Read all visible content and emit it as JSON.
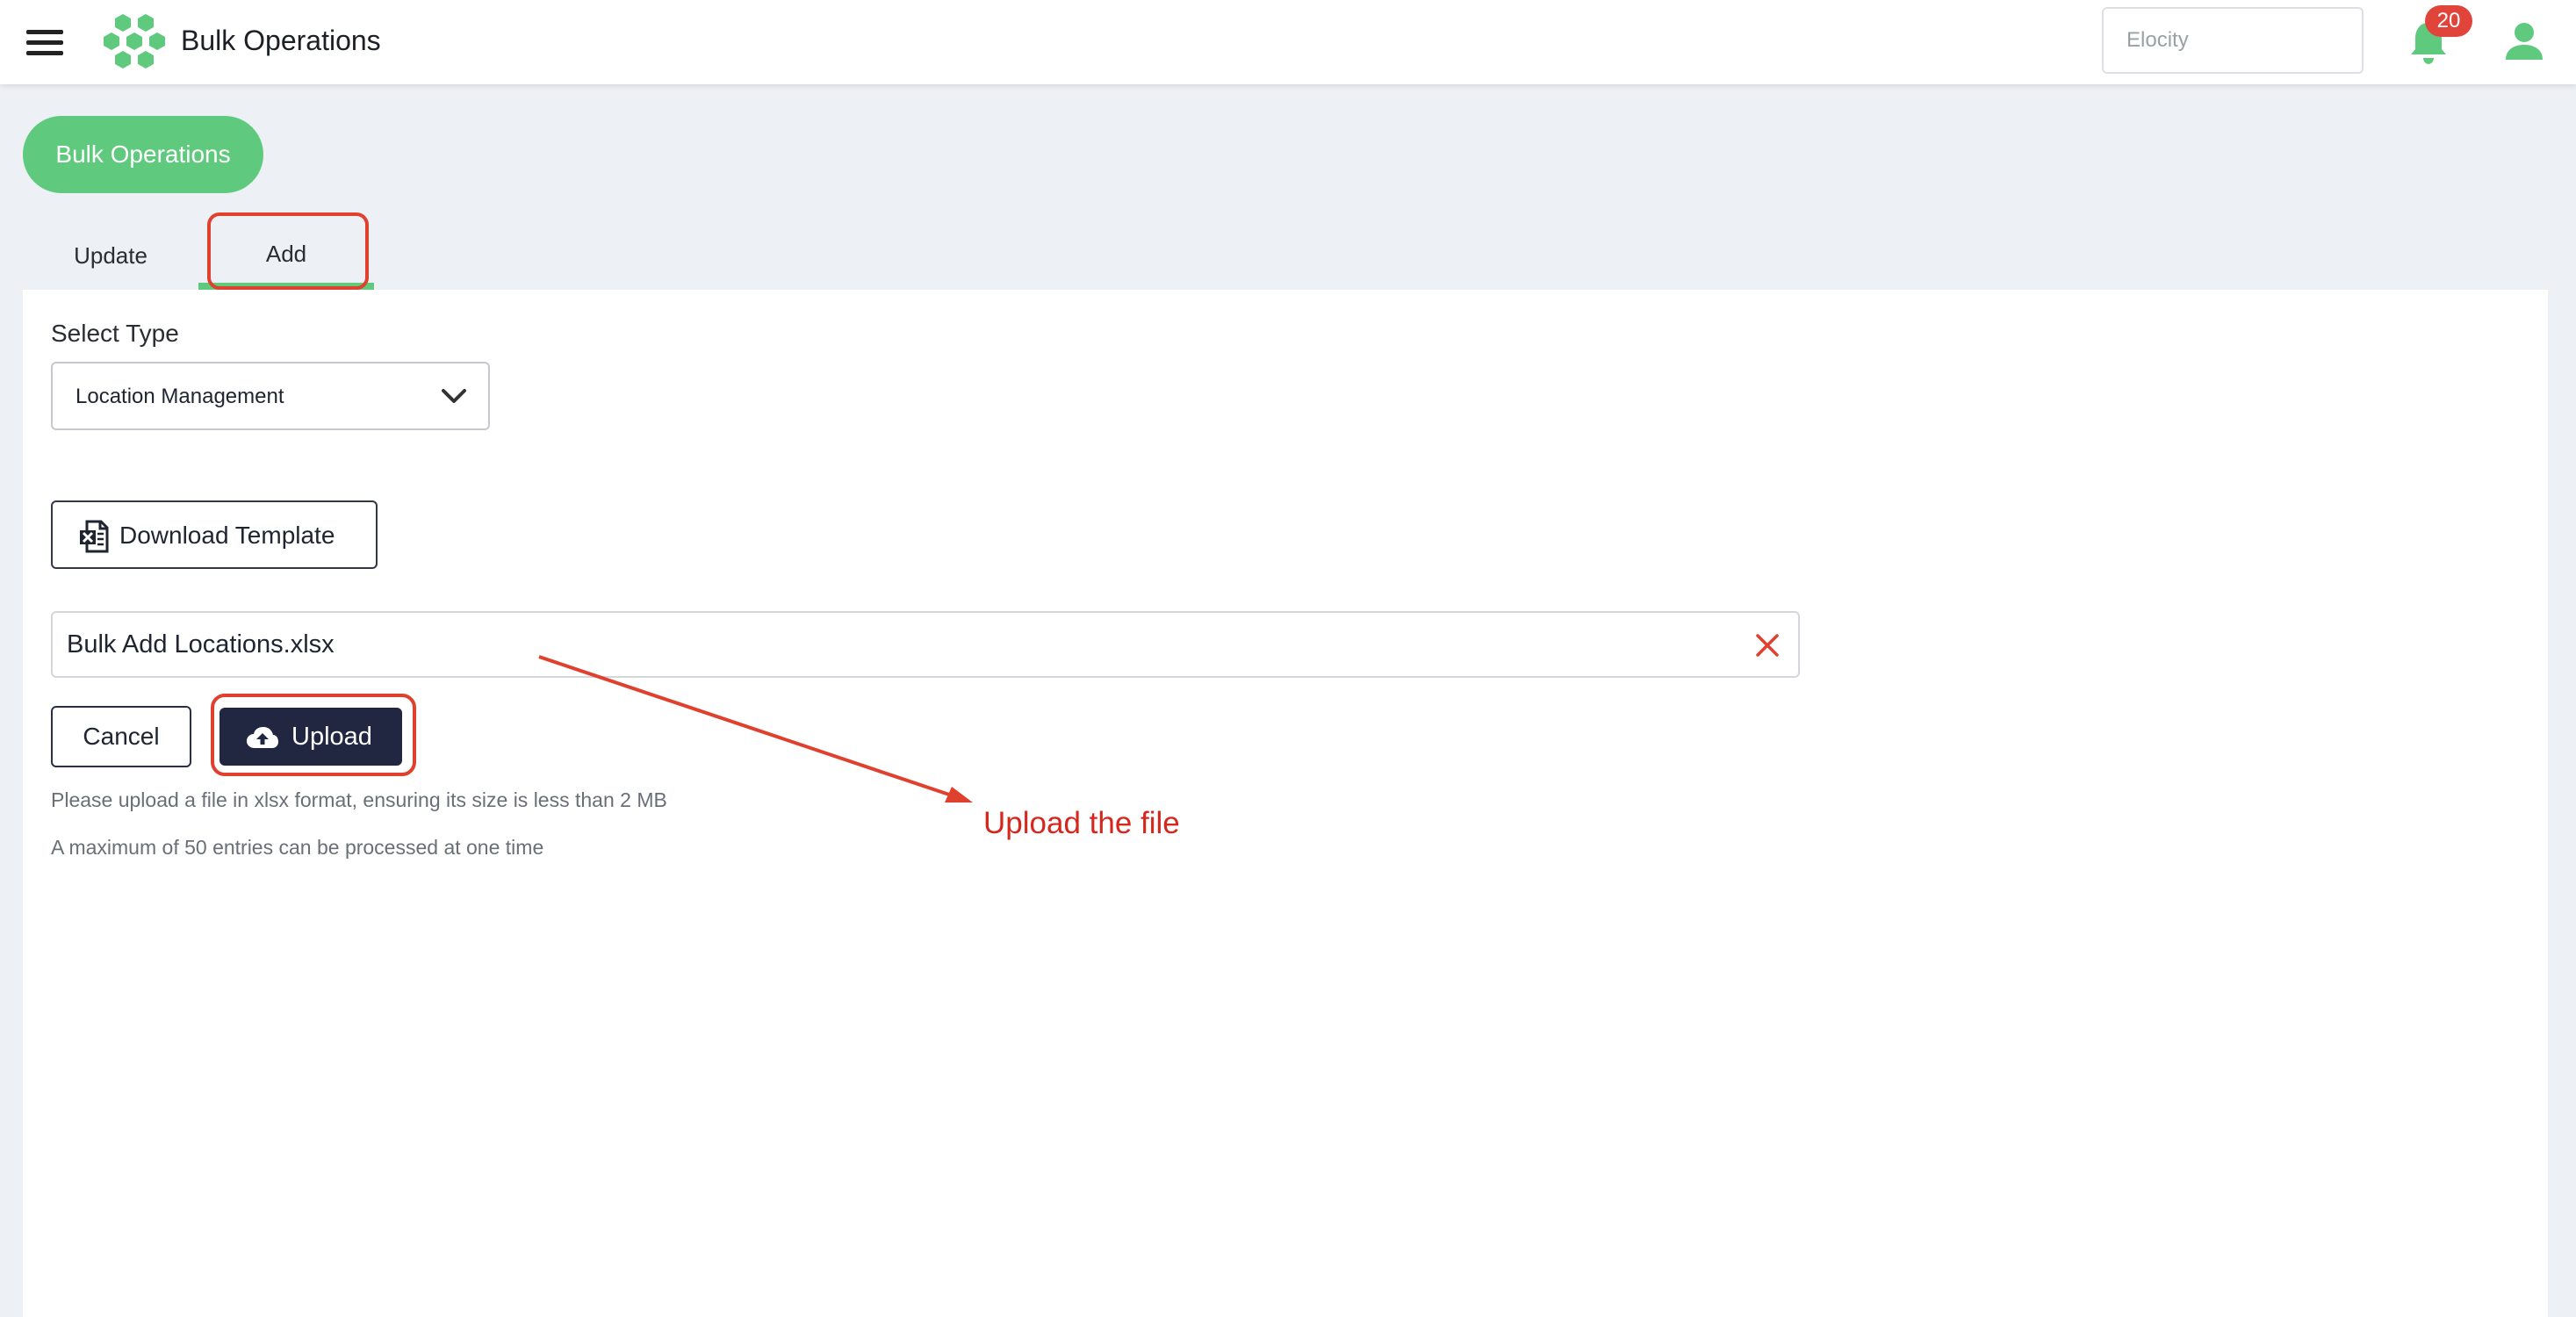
{
  "header": {
    "app_title": "Bulk Operations",
    "org_placeholder": "Elocity",
    "notification_count": "20"
  },
  "page": {
    "title_pill": "Bulk Operations"
  },
  "tabs": [
    {
      "label": "Update",
      "active": false
    },
    {
      "label": "Add",
      "active": true
    }
  ],
  "form": {
    "select_label": "Select Type",
    "select_value": "Location Management",
    "download_label": "Download Template",
    "file_name": "Bulk Add Locations.xlsx",
    "cancel_label": "Cancel",
    "upload_label": "Upload",
    "hint_format": "Please upload a file in xlsx format, ensuring its size is less than 2 MB",
    "hint_limit": "A maximum of 50 entries can be processed at one time"
  },
  "annotation": {
    "text": "Upload the file",
    "color": "#d6271d"
  },
  "colors": {
    "brand_green": "#5fca7e",
    "primary_dark": "#222741",
    "badge_red": "#e0443a",
    "background": "#edf0f5"
  }
}
